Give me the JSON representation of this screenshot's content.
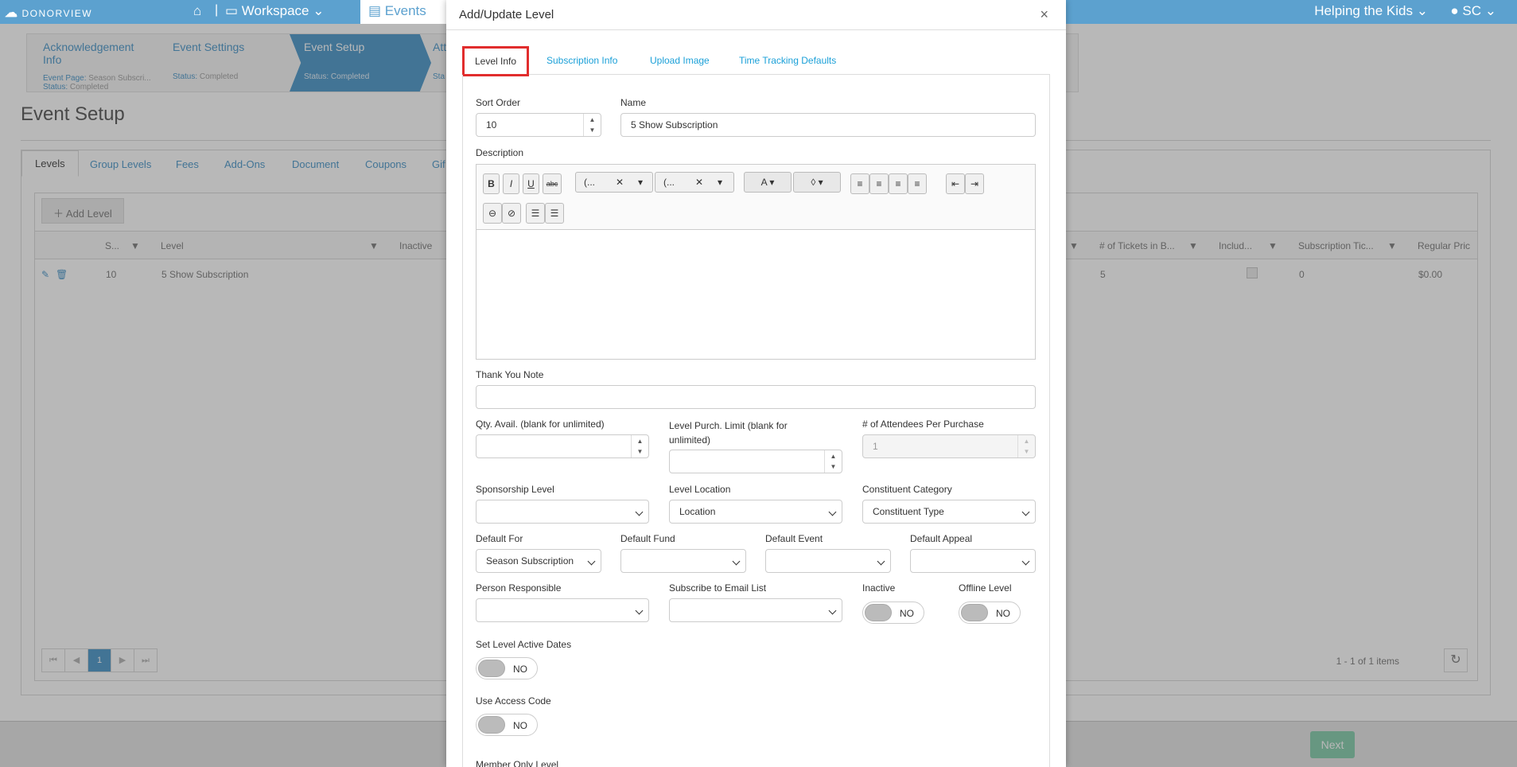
{
  "topbar": {
    "logo": "DONORVIEW",
    "workspace": "Workspace",
    "events": "Events",
    "org": "Helping the Kids",
    "user": "SC"
  },
  "steps": [
    {
      "title": "Acknowledgement Info",
      "line1_label": "Event Page:",
      "line1_value": "Season Subscri...",
      "line2_label": "Status:",
      "line2_value": "Completed"
    },
    {
      "title": "Event Settings",
      "line2_label": "Status:",
      "line2_value": "Completed"
    },
    {
      "title": "Event Setup",
      "line2_label": "Status:",
      "line2_value": "Completed"
    },
    {
      "title": "Att",
      "line2_label": "Sta"
    }
  ],
  "page_title": "Event Setup",
  "page_tabs": [
    "Levels",
    "Group Levels",
    "Fees",
    "Add-Ons",
    "Document",
    "Coupons",
    "Gif"
  ],
  "grid": {
    "add_label": "Add Level",
    "headers_left": [
      "S...",
      "Level",
      "Inactive"
    ],
    "headers_right": [
      "# of Tickets in B...",
      "Includ...",
      "Subscription Tic...",
      "Regular Pric"
    ],
    "row": {
      "sort": "10",
      "level": "5 Show Subscription",
      "tickets": "5",
      "subscription": "0",
      "price": "$0.00"
    },
    "page": "1",
    "items": "1 - 1 of 1 items"
  },
  "footer": {
    "next": "Next"
  },
  "modal": {
    "title": "Add/Update Level",
    "close": "×",
    "tabs": [
      "Level Info",
      "Subscription Info",
      "Upload Image",
      "Time Tracking Defaults"
    ],
    "fields": {
      "sort_order_label": "Sort Order",
      "sort_order": "10",
      "name_label": "Name",
      "name": "5 Show Subscription",
      "description_label": "Description",
      "thank_you_label": "Thank You Note",
      "qty_label": "Qty. Avail. (blank for unlimited)",
      "limit_label": "Level Purch. Limit (blank for unlimited)",
      "attendees_label": "# of Attendees Per Purchase",
      "attendees": "1",
      "sponsorship_label": "Sponsorship Level",
      "location_label": "Level Location",
      "location": "Location",
      "constituent_label": "Constituent Category",
      "constituent": "Constituent Type",
      "default_for_label": "Default For",
      "default_for": "Season Subscription",
      "default_fund_label": "Default Fund",
      "default_event_label": "Default Event",
      "default_appeal_label": "Default Appeal",
      "person_label": "Person Responsible",
      "email_label": "Subscribe to Email List",
      "inactive_label": "Inactive",
      "offline_label": "Offline Level",
      "active_dates_label": "Set Level Active Dates",
      "access_code_label": "Use Access Code",
      "member_label": "Member Only Level",
      "no": "NO"
    },
    "editor": {
      "font1": "(...",
      "font2": "(..."
    }
  },
  "colors": {
    "brand": "#5ca1cf",
    "highlight": "#e12d2d",
    "next": "#8fd1b3"
  }
}
